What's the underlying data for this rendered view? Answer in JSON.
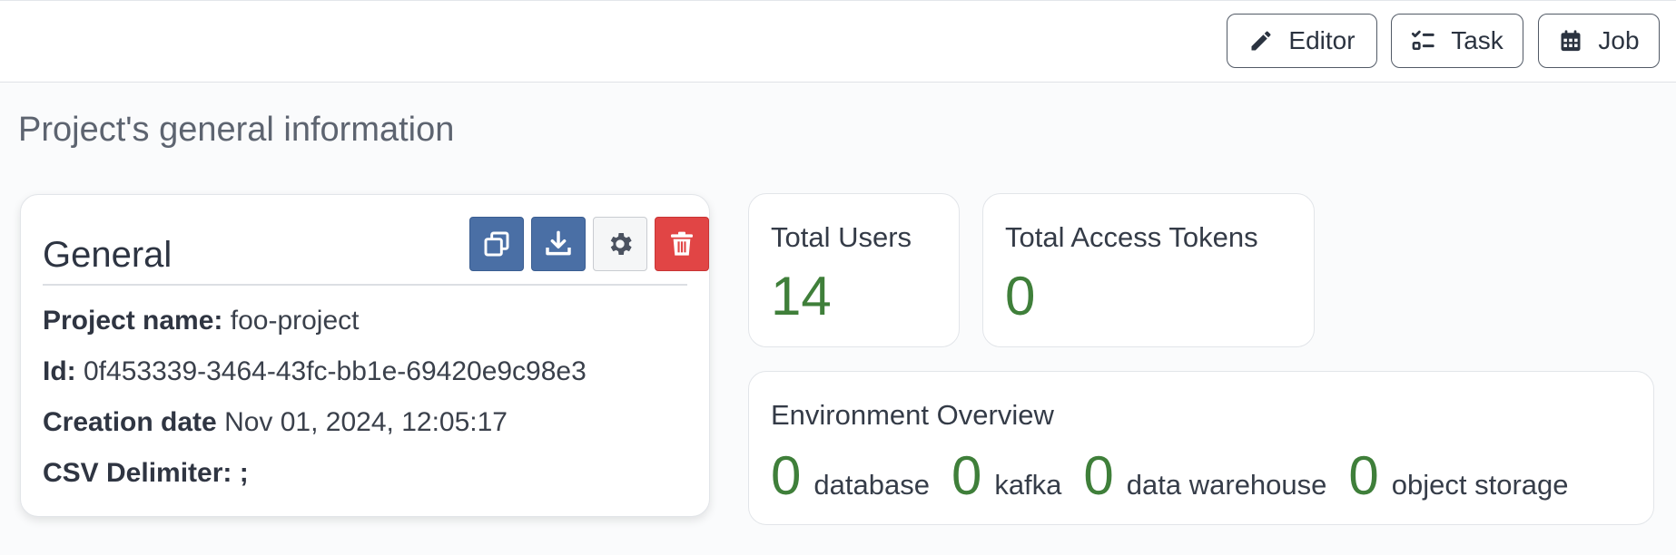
{
  "toolbar": {
    "editor_label": "Editor",
    "task_label": "Task",
    "job_label": "Job"
  },
  "page": {
    "title": "Project's general information"
  },
  "general": {
    "title": "General",
    "rows": [
      {
        "label": "Project name:",
        "value": "foo-project"
      },
      {
        "label": "Id:",
        "value": "0f453339-3464-43fc-bb1e-69420e9c98e3"
      },
      {
        "label": "Creation date",
        "value": "Nov 01, 2024, 12:05:17"
      },
      {
        "label": "CSV Delimiter:",
        "value": ";"
      }
    ],
    "actions": [
      "copy-icon",
      "download-icon",
      "gear-icon",
      "trash-icon"
    ]
  },
  "stats": {
    "users": {
      "label": "Total Users",
      "value": "14"
    },
    "tokens": {
      "label": "Total Access Tokens",
      "value": "0"
    }
  },
  "environment": {
    "title": "Environment Overview",
    "items": [
      {
        "count": "0",
        "label": "database"
      },
      {
        "count": "0",
        "label": "kafka"
      },
      {
        "count": "0",
        "label": "data warehouse"
      },
      {
        "count": "0",
        "label": "object storage"
      }
    ]
  },
  "colors": {
    "accent_blue": "#4a6fa5",
    "danger_red": "#e14545",
    "stat_green": "#3f7f3a"
  }
}
